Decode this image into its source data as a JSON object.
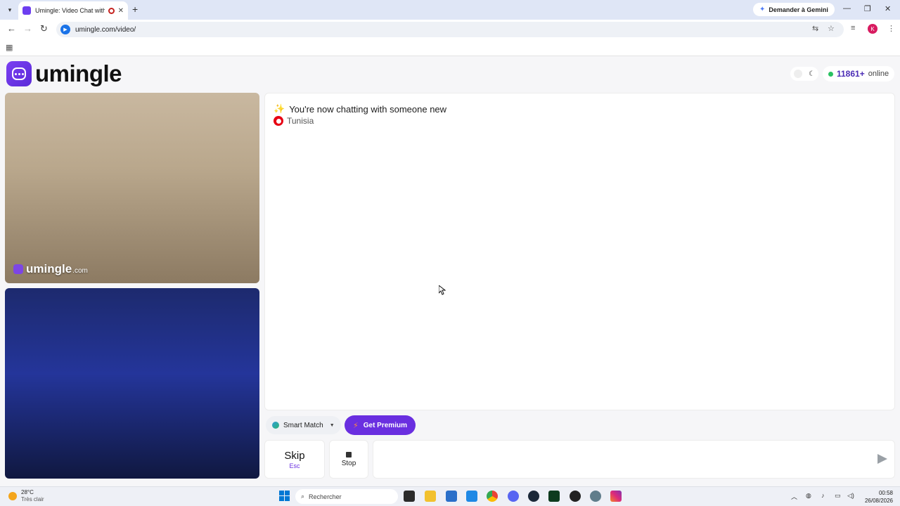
{
  "browser": {
    "tab_title": "Umingle: Video Chat with S",
    "new_tab_symbol": "+",
    "gemini_label": "Demander à Gemini",
    "url": "umingle.com/video/",
    "profile_initial": "K"
  },
  "header": {
    "logo_text": "umingle",
    "online_count": "11861+",
    "online_label": "online"
  },
  "video": {
    "watermark_brand": "umingle",
    "watermark_domain": ".com"
  },
  "chat": {
    "status_message": "You're now chatting with someone new",
    "country": "Tunisia",
    "message_placeholder": ""
  },
  "controls": {
    "smart_match_label": "Smart Match",
    "premium_label": "Get Premium",
    "skip_label": "Skip",
    "skip_shortcut": "Esc",
    "stop_label": "Stop"
  },
  "taskbar": {
    "temperature": "28°C",
    "weather": "Très clair",
    "search_label": "Rechercher",
    "time": "00:58",
    "date": "26/08/2026"
  },
  "colors": {
    "brand_purple": "#6a2fe0",
    "online_green": "#29c261",
    "tunisia_red": "#e70013"
  }
}
